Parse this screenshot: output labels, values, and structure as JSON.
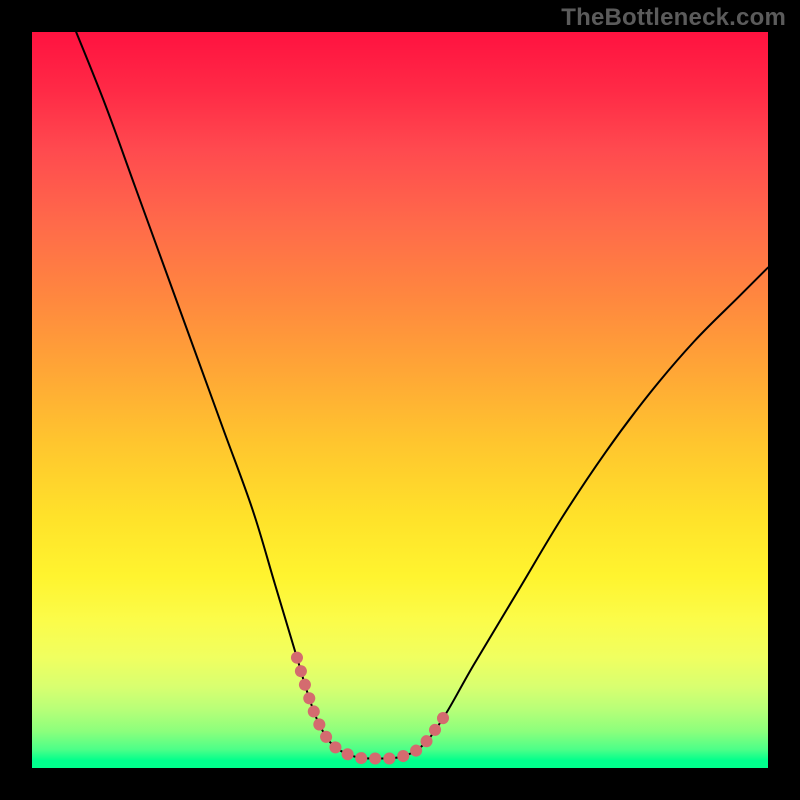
{
  "watermark": "TheBottleneck.com",
  "chart_data": {
    "type": "line",
    "title": "",
    "xlabel": "",
    "ylabel": "",
    "xlim": [
      0,
      100
    ],
    "ylim": [
      0,
      100
    ],
    "grid": false,
    "legend": false,
    "series": [
      {
        "name": "bottleneck-curve",
        "color": "#000000",
        "stroke_width": 2,
        "x": [
          6,
          10,
          14,
          18,
          22,
          26,
          30,
          33,
          36,
          37.5,
          39,
          41,
          44,
          47,
          50,
          53,
          56,
          60,
          66,
          72,
          78,
          84,
          90,
          96,
          100
        ],
        "y": [
          100,
          90,
          79,
          68,
          57,
          46,
          35,
          25,
          15,
          10,
          6,
          3,
          1.5,
          1.3,
          1.5,
          3,
          7,
          14,
          24,
          34,
          43,
          51,
          58,
          64,
          68
        ]
      },
      {
        "name": "valley-highlight",
        "color": "#d46b6f",
        "stroke_width": 12,
        "x": [
          36,
          37.5,
          39,
          41,
          44,
          47,
          50,
          53,
          56
        ],
        "y": [
          15,
          10,
          6,
          3,
          1.5,
          1.3,
          1.5,
          3,
          7
        ]
      }
    ]
  }
}
